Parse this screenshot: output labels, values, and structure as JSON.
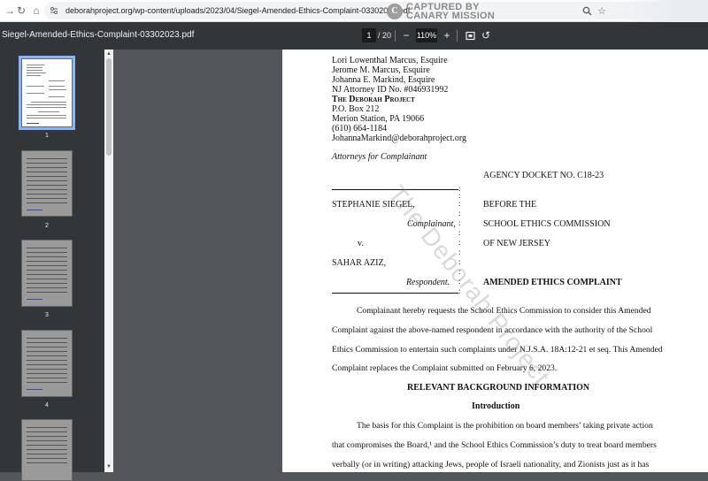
{
  "browser": {
    "url": "deborahproject.org/wp-content/uploads/2023/04/Siegel-Amended-Ethics-Complaint-03302023.pdf",
    "watermark_line1": "CAPTURED BY",
    "watermark_line2": "CANARY MISSION",
    "watermark_logo": "C"
  },
  "toolbar": {
    "file_name": "Siegel-Amended-Ethics-Complaint-03302023.pdf",
    "current_page": "1",
    "total_pages": "/ 20",
    "zoom": "110%"
  },
  "sidebar": {
    "thumbnails": [
      "1",
      "2",
      "3",
      "4"
    ]
  },
  "document": {
    "header_lines": [
      "Lori Lowenthal Marcus, Esquire",
      "Jerome M. Marcus, Esquire",
      "Johanna E. Markind, Esquire",
      "NJ Attorney ID No. #046931992",
      "The Deborah Project",
      "P.O. Box 212",
      "Merion Station, PA 19066",
      "(610) 664-1184",
      "JohannaMarkind@deborahproject.org"
    ],
    "attorneys_for": "Attorneys for Complainant",
    "docket": "AGENCY DOCKET NO. C18-23",
    "complainant_name": "STEPHANIE SIEGEL,",
    "complainant_label": "Complainant,",
    "versus": "v.",
    "respondent_name": "SAHAR AZIZ,",
    "respondent_label": "Respondent.",
    "before": "BEFORE THE",
    "commission": "SCHOOL ETHICS COMMISSION",
    "state": "OF NEW JERSEY",
    "complaint_title": "AMENDED ETHICS COMPLAINT",
    "intro_lines": [
      "Complainant hereby requests the School Ethics Commission to consider this Amended",
      "Complaint against the above-named respondent in accordance with the authority of the School",
      "Ethics Commission to entertain such complaints under N.J.S.A. 18A:12-21 et seq. This Amended",
      "Complaint replaces the Complaint submitted on February 6, 2023."
    ],
    "section_heading": "RELEVANT BACKGROUND INFORMATION",
    "subsection_heading": "Introduction",
    "body_lines": [
      "The basis for this Complaint is the prohibition on board members’ taking private action",
      "that compromises the Board,¹ and the School Ethics Commission’s duty to treat board members",
      "verbally (or in writing) attacking Jews, people of Israeli nationality, and Zionists just as it has"
    ],
    "diagonal_watermark": "The Deborah Project"
  }
}
